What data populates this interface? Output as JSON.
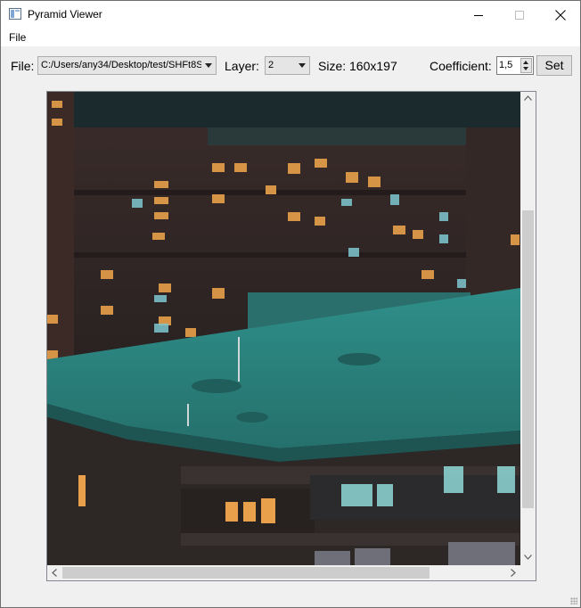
{
  "window": {
    "title": "Pyramid Viewer"
  },
  "menu": {
    "file": "File"
  },
  "toolbar": {
    "file_label": "File:",
    "file_value": "C:/Users/any34/Desktop/test/SHFt8S",
    "layer_label": "Layer:",
    "layer_value": "2",
    "size_text": "Size: 160x197",
    "coefficient_label": "Coefficient:",
    "coefficient_value": "1,5",
    "set_label": "Set"
  },
  "icons": [
    "app-icon",
    "minimize-icon",
    "maximize-icon",
    "close-icon",
    "chevron-down-icon",
    "spin-up-icon",
    "spin-down-icon",
    "scroll-up-icon",
    "scroll-down-icon",
    "scroll-left-icon",
    "scroll-right-icon",
    "resize-grip-icon"
  ],
  "colors": {
    "roof_teal": "#2f8f8a",
    "window_glow": "#e8a04a",
    "facade_dark": "#2b2222"
  }
}
